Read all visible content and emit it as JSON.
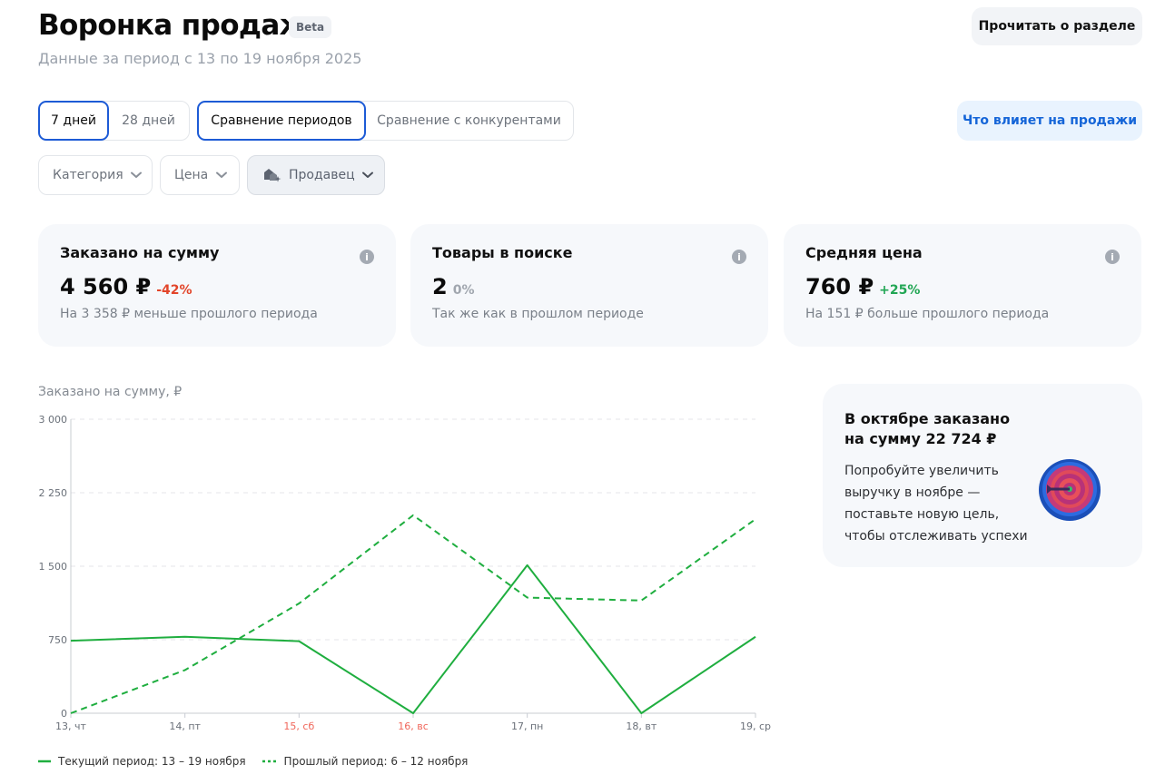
{
  "header": {
    "title": "Воронка продаж",
    "badge": "Beta",
    "subtitle": "Данные за период с 13 по 19 ноября 2025",
    "read_button": "Прочитать о разделе"
  },
  "period_tabs": [
    {
      "label": "7 дней",
      "active": true
    },
    {
      "label": "28 дней",
      "active": false
    }
  ],
  "compare_tabs": [
    {
      "label": "Сравнение периодов",
      "active": true
    },
    {
      "label": "Сравнение с конкурентами",
      "active": false
    }
  ],
  "influence_button": "Что влияет на продажи",
  "filters": [
    {
      "label": "Категория",
      "icon": "chevron-down-icon"
    },
    {
      "label": "Цена",
      "icon": "chevron-down-icon"
    },
    {
      "label": "Продавец",
      "icon": "sellers-icon"
    }
  ],
  "metrics": [
    {
      "title": "Заказано на сумму",
      "value": "4 560 ₽",
      "delta": "-42%",
      "delta_kind": "neg",
      "description": "На 3 358 ₽ меньше прошлого периода"
    },
    {
      "title": "Товары в поиске",
      "value": "2",
      "delta": "0%",
      "delta_kind": "neu",
      "description": "Так же как в прошлом периоде"
    },
    {
      "title": "Средняя цена",
      "value": "760 ₽",
      "delta": "+25%",
      "delta_kind": "pos",
      "description": "На 151 ₽ больше прошлого периода"
    }
  ],
  "chart_title": "Заказано на сумму, ₽",
  "chart_data": {
    "type": "line",
    "categories": [
      "13, чт",
      "14, пт",
      "15, сб",
      "16, вс",
      "17, пн",
      "18, вт",
      "19, ср"
    ],
    "weekend": [
      false,
      false,
      true,
      true,
      false,
      false,
      false
    ],
    "ylim": [
      0,
      3000
    ],
    "yticks": [
      0,
      750,
      1500,
      2250,
      3000
    ],
    "ytick_labels": [
      "0",
      "750",
      "1 500",
      "2 250",
      "3 000"
    ],
    "grid": true,
    "series": [
      {
        "name": "Текущий период: 13 – 19 ноября",
        "style": "solid",
        "color": "#1fae3f",
        "values": [
          740,
          780,
          735,
          0,
          1510,
          0,
          780
        ]
      },
      {
        "name": "Прошлый период: 6 – 12 ноября",
        "style": "dashed",
        "color": "#1fae3f",
        "values": [
          0,
          440,
          1120,
          2020,
          1180,
          1150,
          1980
        ]
      }
    ]
  },
  "promo": {
    "heading": "В октябре заказано на сумму 22 724 ₽",
    "text": "Попробуйте увеличить выручку в ноябре — поставьте новую цель, чтобы отслеживать успехи",
    "icon": "target-icon"
  },
  "colors": {
    "accent": "#1d5bd6",
    "green": "#1fae3f",
    "red": "#e2452a",
    "weekend": "#f0665a"
  }
}
